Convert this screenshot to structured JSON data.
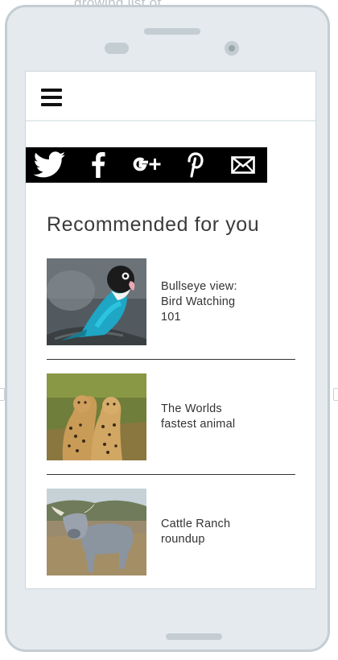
{
  "background_fragment": "growing list of",
  "share": {
    "items": [
      {
        "name": "twitter"
      },
      {
        "name": "facebook"
      },
      {
        "name": "google-plus"
      },
      {
        "name": "pinterest"
      },
      {
        "name": "email"
      }
    ]
  },
  "section": {
    "title": "Recommended for you"
  },
  "articles": [
    {
      "title_line1": "Bullseye view:",
      "title_line2": "Bird Watching",
      "title_line3": "101"
    },
    {
      "title_line1": "The Worlds",
      "title_line2": "fastest animal",
      "title_line3": ""
    },
    {
      "title_line1": "Cattle Ranch",
      "title_line2": "roundup",
      "title_line3": ""
    }
  ]
}
